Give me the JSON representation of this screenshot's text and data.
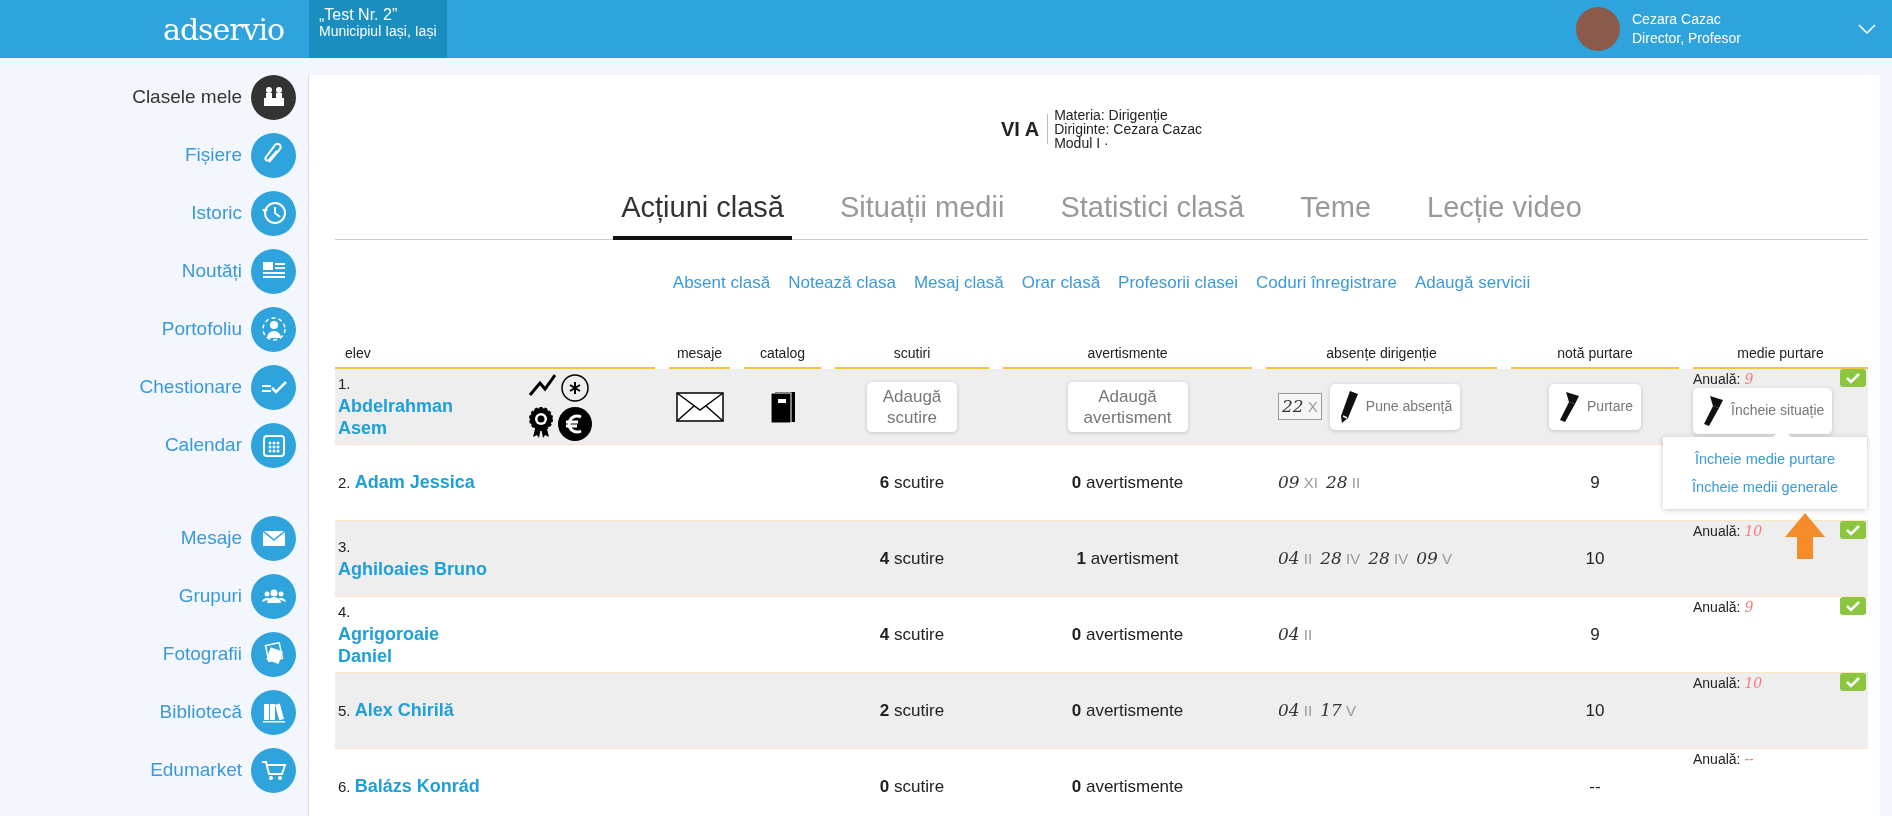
{
  "topbar": {
    "logo": "adservio",
    "school": {
      "name": "„Test Nr. 2”",
      "location": "Municipiul Iași, Iași"
    },
    "user": {
      "name": "Cezara Cazac",
      "role": "Director, Profesor"
    }
  },
  "sidebar": {
    "groups": [
      [
        {
          "label": "Clasele mele",
          "selected": true
        },
        {
          "label": "Fișiere",
          "selected": false
        },
        {
          "label": "Istoric",
          "selected": false
        },
        {
          "label": "Noutăți",
          "selected": false
        },
        {
          "label": "Portofoliu",
          "selected": false
        },
        {
          "label": "Chestionare",
          "selected": false
        },
        {
          "label": "Calendar",
          "selected": false
        }
      ],
      [
        {
          "label": "Mesaje",
          "selected": false
        },
        {
          "label": "Grupuri",
          "selected": false
        },
        {
          "label": "Fotografii",
          "selected": false
        },
        {
          "label": "Bibliotecă",
          "selected": false
        },
        {
          "label": "Edumarket",
          "selected": false
        }
      ]
    ]
  },
  "class_header": {
    "name": "VI A",
    "details": [
      "Materia: Dirigenție",
      "Diriginte: Cezara Cazac",
      "Modul I ·"
    ]
  },
  "tabs": [
    {
      "label": "Acțiuni clasă",
      "selected": true
    },
    {
      "label": "Situații medii",
      "selected": false
    },
    {
      "label": "Statistici clasă",
      "selected": false
    },
    {
      "label": "Teme",
      "selected": false
    },
    {
      "label": "Lecție video",
      "selected": false
    }
  ],
  "actions": [
    "Absent clasă",
    "Notează clasa",
    "Mesaj clasă",
    "Orar clasă",
    "Profesorii clasei",
    "Coduri înregistrare",
    "Adaugă servicii"
  ],
  "table": {
    "columns": [
      "elev",
      "mesaje",
      "catalog",
      "scutiri",
      "avertismente",
      "absențe dirigenție",
      "notă purtare",
      "medie purtare"
    ],
    "rows": [
      {
        "number": "1.",
        "name": "Abdelrahman Asem",
        "has_tools": true,
        "scutiri": {
          "kind": "button",
          "label": "Adaugă scutire"
        },
        "avertismente": {
          "kind": "button",
          "label": "Adaugă avertisment"
        },
        "absences": [
          {
            "day": "22",
            "month": "X",
            "boxed": true
          }
        ],
        "absence_button": "Pune absență",
        "nota": {
          "kind": "button",
          "label": "Purtare"
        },
        "medie": {
          "label": "Anuală:",
          "value": "9",
          "checked": true,
          "button": "Încheie situație",
          "menu": [
            "Încheie medie purtare",
            "Încheie medii generale"
          ]
        }
      },
      {
        "number": "2.",
        "name": "Adam Jessica",
        "has_tools": false,
        "scutiri": {
          "kind": "count",
          "count": "6",
          "label": "scutire"
        },
        "avertismente": {
          "kind": "count",
          "count": "0",
          "label": "avertismente"
        },
        "absences": [
          {
            "day": "09",
            "month": "XI",
            "boxed": false
          },
          {
            "day": "28",
            "month": "II",
            "boxed": false
          }
        ],
        "nota": {
          "kind": "value",
          "value": "9"
        }
      },
      {
        "number": "3.",
        "name": "Aghiloaies Bruno",
        "has_tools": false,
        "scutiri": {
          "kind": "count",
          "count": "4",
          "label": "scutire"
        },
        "avertismente": {
          "kind": "count",
          "count": "1",
          "label": "avertisment"
        },
        "absences": [
          {
            "day": "04",
            "month": "II",
            "boxed": false
          },
          {
            "day": "28",
            "month": "IV",
            "boxed": false
          },
          {
            "day": "28",
            "month": "IV",
            "boxed": false
          },
          {
            "day": "09",
            "month": "V",
            "boxed": false
          }
        ],
        "nota": {
          "kind": "value",
          "value": "10"
        },
        "medie": {
          "label": "Anuală:",
          "value": "10",
          "checked": true
        }
      },
      {
        "number": "4.",
        "name": "Agrigoroaie Daniel",
        "has_tools": false,
        "scutiri": {
          "kind": "count",
          "count": "4",
          "label": "scutire"
        },
        "avertismente": {
          "kind": "count",
          "count": "0",
          "label": "avertismente"
        },
        "absences": [
          {
            "day": "04",
            "month": "II",
            "boxed": false
          }
        ],
        "nota": {
          "kind": "value",
          "value": "9"
        },
        "medie": {
          "label": "Anuală:",
          "value": "9",
          "checked": true
        }
      },
      {
        "number": "5.",
        "name": "Alex Chirilă",
        "has_tools": false,
        "scutiri": {
          "kind": "count",
          "count": "2",
          "label": "scutire"
        },
        "avertismente": {
          "kind": "count",
          "count": "0",
          "label": "avertismente"
        },
        "absences": [
          {
            "day": "04",
            "month": "II",
            "boxed": false
          },
          {
            "day": "17",
            "month": "V",
            "boxed": false
          }
        ],
        "nota": {
          "kind": "value",
          "value": "10"
        },
        "medie": {
          "label": "Anuală:",
          "value": "10",
          "checked": true
        }
      },
      {
        "number": "6.",
        "name": "Balázs Konrád",
        "has_tools": false,
        "scutiri": {
          "kind": "count",
          "count": "0",
          "label": "scutire"
        },
        "avertismente": {
          "kind": "count",
          "count": "0",
          "label": "avertismente"
        },
        "absences": [],
        "nota": {
          "kind": "value",
          "value": "--"
        },
        "medie": {
          "label": "Anuală:",
          "value": "--",
          "checked": false
        }
      }
    ]
  }
}
